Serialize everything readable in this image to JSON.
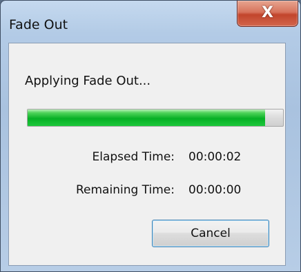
{
  "window": {
    "title": "Fade Out",
    "close_glyph": "X",
    "close_icon": "close-icon"
  },
  "dialog": {
    "status_text": "Applying Fade Out...",
    "progress_fraction": 0.93,
    "elapsed_label": "Elapsed Time:",
    "elapsed_value": "00:00:02",
    "remaining_label": "Remaining Time:",
    "remaining_value": "00:00:00",
    "cancel_label": "Cancel"
  },
  "colors": {
    "progress_green": "#06b025",
    "close_red": "#c2452c",
    "window_frame": "#a9c2df",
    "client_background": "#f0f0f0"
  }
}
